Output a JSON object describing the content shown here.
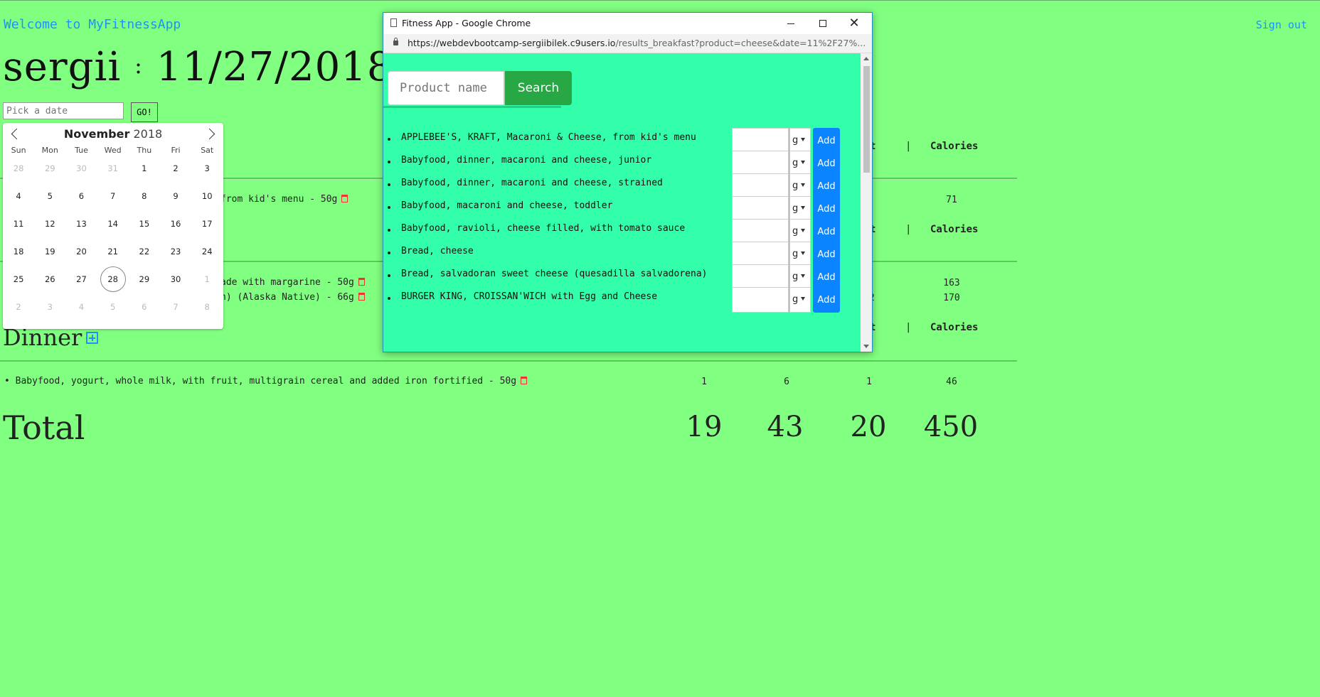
{
  "app": {
    "welcome": "Welcome to MyFitnessApp",
    "signout": "Sign out",
    "user": "sergii",
    "date_separator": ":",
    "date": "11/27/2018",
    "date_placeholder": "Pick a date",
    "go_label": "GO!"
  },
  "calendar": {
    "month": "November",
    "year": "2018",
    "weekdays": [
      "Sun",
      "Mon",
      "Tue",
      "Wed",
      "Thu",
      "Fri",
      "Sat"
    ],
    "weeks": [
      [
        "28",
        "29",
        "30",
        "31",
        "1",
        "2",
        "3"
      ],
      [
        "4",
        "5",
        "6",
        "7",
        "8",
        "9",
        "10"
      ],
      [
        "11",
        "12",
        "13",
        "14",
        "15",
        "16",
        "17"
      ],
      [
        "18",
        "19",
        "20",
        "21",
        "22",
        "23",
        "24"
      ],
      [
        "25",
        "26",
        "27",
        "28",
        "29",
        "30",
        "1"
      ],
      [
        "2",
        "3",
        "4",
        "5",
        "6",
        "7",
        "8"
      ]
    ],
    "selected_day": "28"
  },
  "log": {
    "col_t": "t",
    "pipe": "|",
    "calories_header": "Calories",
    "section1_row": "from kid's menu - 50g",
    "section1_calories": "71",
    "section2_row1": "ade with margarine - 50g",
    "section2_row1_calories": "163",
    "section2_row2": "n) (Alaska Native) - 66g",
    "section2_row2_partial": "2",
    "section2_row2_calories": "170",
    "dinner_title": "Dinner",
    "dinner_row": "Babyfood, yogurt, whole milk, with fruit, multigrain cereal and added iron fortified - 50g",
    "dinner_values": [
      "1",
      "6",
      "1",
      "46"
    ],
    "total_label": "Total",
    "totals": [
      "19",
      "43",
      "20",
      "450"
    ]
  },
  "popup": {
    "window_title": "Fitness App - Google Chrome",
    "url_host": "https://webdevbootcamp-sergiibilek.c9users.io",
    "url_path": "/results_breakfast?product=cheese&date=11%2F27%...",
    "search_placeholder": "Product name",
    "search_label": "Search",
    "unit": "g",
    "add_label": "Add",
    "results": [
      "APPLEBEE'S, KRAFT, Macaroni & Cheese, from kid's menu",
      "Babyfood, dinner, macaroni and cheese, junior",
      "Babyfood, dinner, macaroni and cheese, strained",
      "Babyfood, macaroni and cheese, toddler",
      "Babyfood, ravioli, cheese filled, with tomato sauce",
      "Bread, cheese",
      "Bread, salvadoran sweet cheese (quesadilla salvadorena)",
      "BURGER KING, CROISSAN'WICH with Egg and Cheese"
    ]
  }
}
